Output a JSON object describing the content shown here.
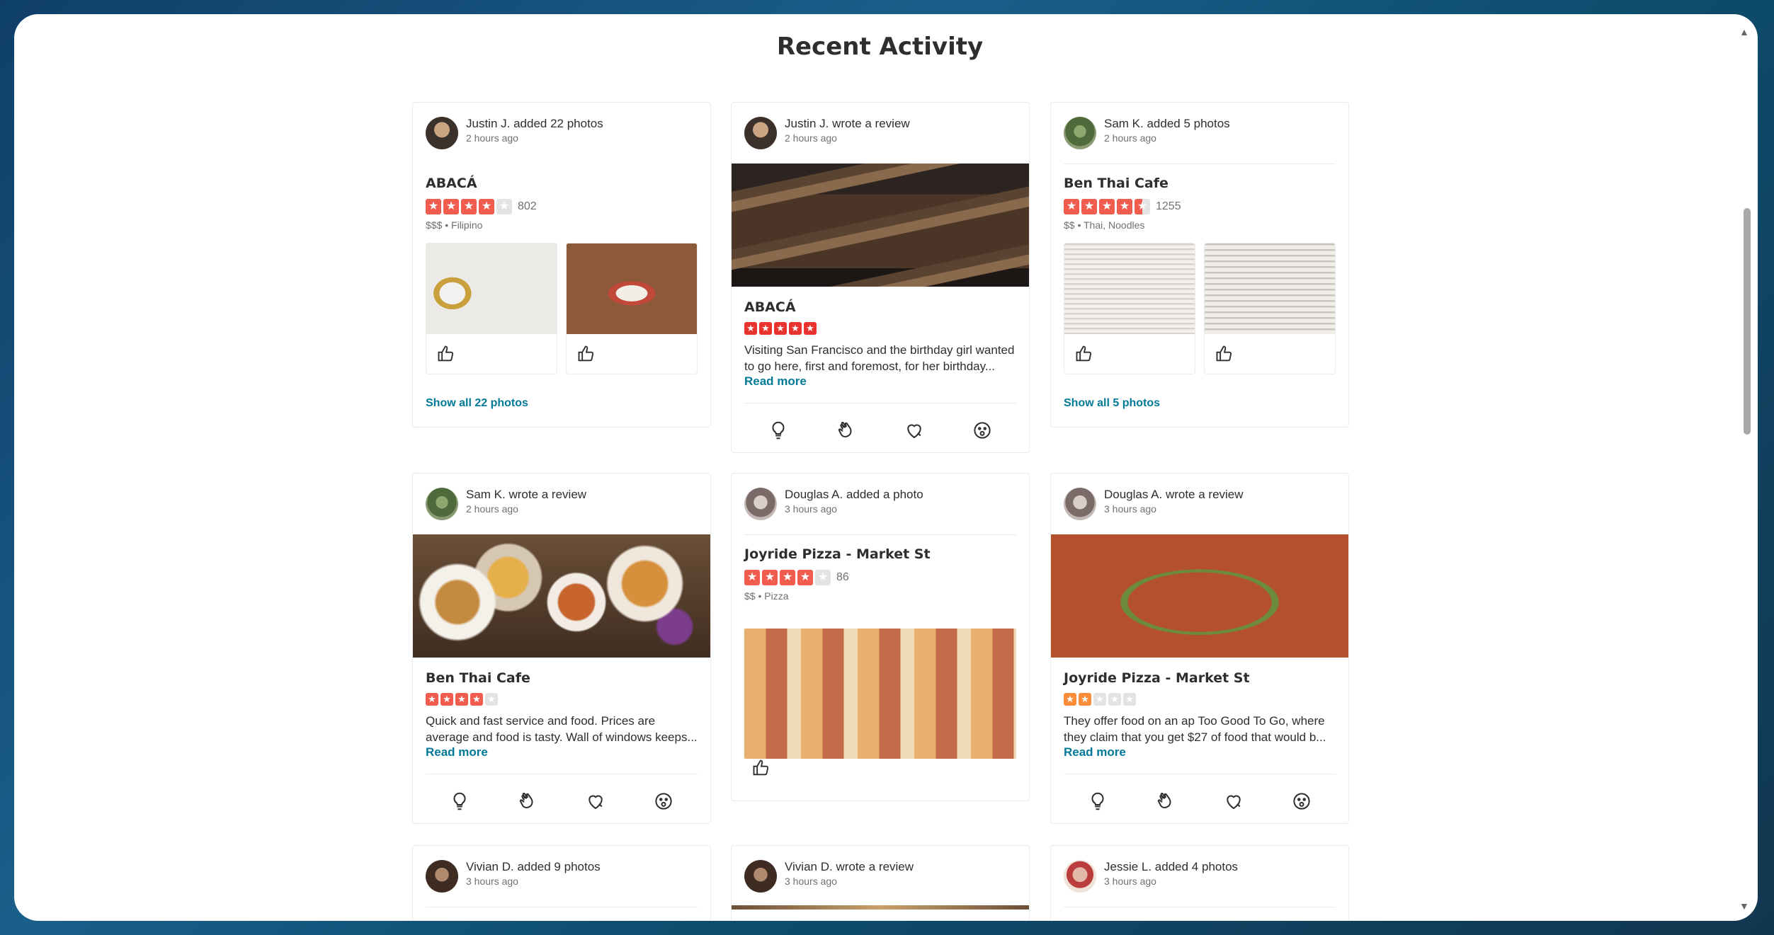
{
  "page": {
    "title": "Recent Activity"
  },
  "cards": [
    {
      "actor": "Justin J. added 22 photos",
      "time": "2 hours ago",
      "business": "ABACÁ",
      "review_count": "802",
      "meta": "$$$ • Filipino",
      "show_all": "Show all 22 photos",
      "rating": 4
    },
    {
      "actor": "Justin J. wrote a review",
      "time": "2 hours ago",
      "business": "ABACÁ",
      "rating": 5,
      "text": "Visiting San Francisco and the birthday girl wanted to go here, first and foremost, for her birthday...",
      "read_more": "Read more"
    },
    {
      "actor": "Sam K. added 5 photos",
      "time": "2 hours ago",
      "business": "Ben Thai Cafe",
      "review_count": "1255",
      "meta": "$$ • Thai, Noodles",
      "show_all": "Show all 5 photos",
      "rating": 4.5
    },
    {
      "actor": "Sam K. wrote a review",
      "time": "2 hours ago",
      "business": "Ben Thai Cafe",
      "rating": 4,
      "text": "Quick and fast service and food. Prices are average and food is tasty. Wall of windows keeps...",
      "read_more": "Read more"
    },
    {
      "actor": "Douglas A. added a photo",
      "time": "3 hours ago",
      "business": "Joyride Pizza - Market St",
      "review_count": "86",
      "meta": "$$ • Pizza",
      "rating": 4
    },
    {
      "actor": "Douglas A. wrote a review",
      "time": "3 hours ago",
      "business": "Joyride Pizza - Market St",
      "rating": 2,
      "text": "They offer food on an ap Too Good To Go, where they claim that you get $27 of food that would b...",
      "read_more": "Read more"
    },
    {
      "actor": "Vivian D. added 9 photos",
      "time": "3 hours ago"
    },
    {
      "actor": "Vivian D. wrote a review",
      "time": "3 hours ago"
    },
    {
      "actor": "Jessie L. added 4 photos",
      "time": "3 hours ago"
    }
  ],
  "icons": {
    "like": "thumbs-up-icon",
    "reactions": [
      "lightbulb-icon",
      "clap-hands-icon",
      "heart-icon",
      "surprised-face-icon"
    ],
    "scroll_up": "▲",
    "scroll_down": "▼"
  },
  "colors": {
    "star": "#f15c4f",
    "star_five": "#e8322d",
    "star_two": "#fb8d3a",
    "link": "#027a97"
  }
}
